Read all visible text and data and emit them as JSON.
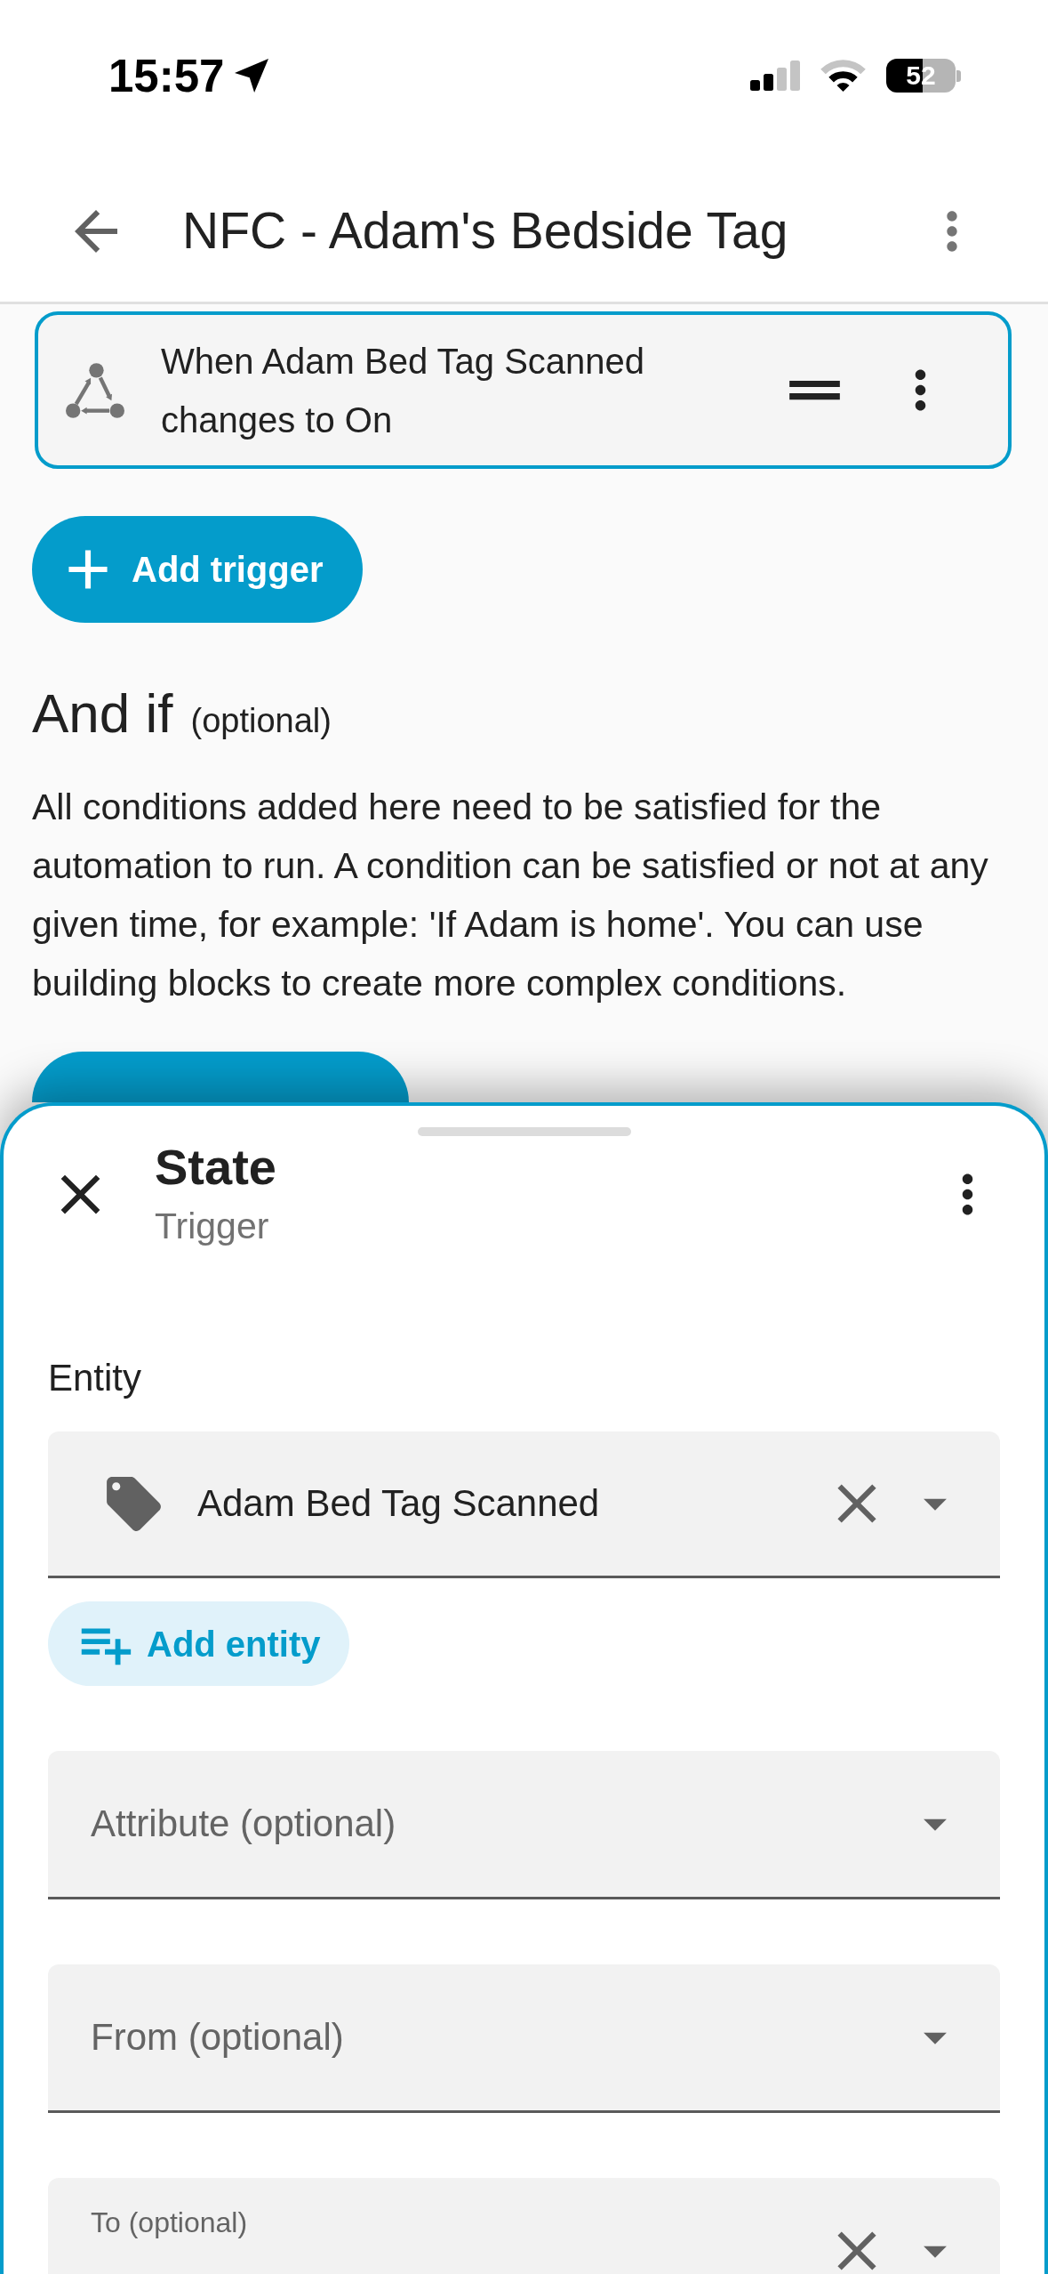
{
  "status_bar": {
    "time": "15:57",
    "battery": "52"
  },
  "header": {
    "title": "NFC - Adam's Bedside Tag"
  },
  "triggers": [
    {
      "description": "When Adam Bed Tag Scanned changes to On",
      "selected": true
    }
  ],
  "add_trigger": {
    "label": "Add trigger"
  },
  "conditions": {
    "title": "And if",
    "note": "(optional)",
    "description": "All conditions added here need to be satisfied for the automation to run. A condition can be satisfied or not at any given time, for example: 'If Adam is home'. You can use building blocks to create more complex conditions."
  },
  "sheet": {
    "title": "State",
    "subtitle": "Trigger",
    "entity": {
      "label": "Entity",
      "value": "Adam Bed Tag Scanned",
      "add_label": "Add entity"
    },
    "fields": [
      {
        "label": "Attribute (optional)",
        "filled": false
      },
      {
        "label": "From (optional)",
        "filled": false
      },
      {
        "label": "To (optional)",
        "filled": true
      }
    ]
  }
}
